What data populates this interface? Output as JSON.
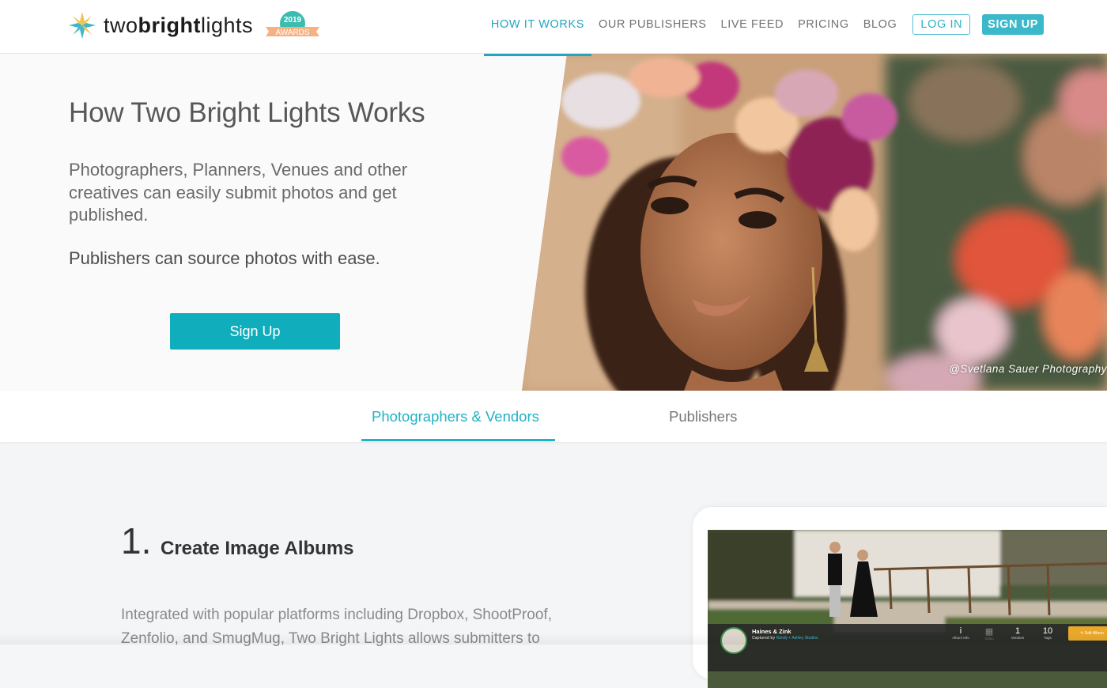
{
  "header": {
    "logo": {
      "text_light_1": "two",
      "text_bold": "bright",
      "text_light_2": "lights"
    },
    "award_badge": {
      "year": "2019",
      "label": "AWARDS"
    },
    "nav": [
      {
        "label": "HOW IT WORKS",
        "active": true
      },
      {
        "label": "OUR PUBLISHERS",
        "active": false
      },
      {
        "label": "LIVE FEED",
        "active": false
      },
      {
        "label": "PRICING",
        "active": false
      },
      {
        "label": "BLOG",
        "active": false
      }
    ],
    "login_label": "LOG IN",
    "signup_label": "SIGN UP"
  },
  "hero": {
    "title": "How Two Bright Lights Works",
    "description": "Photographers, Planners, Venues and other creatives can easily submit photos and get published.",
    "subtitle": "Publishers can source photos with ease.",
    "cta_label": "Sign Up",
    "photo_credit": "@Svetlana Sauer Photography"
  },
  "tabs": [
    {
      "label": "Photographers & Vendors",
      "active": true
    },
    {
      "label": "Publishers",
      "active": false
    }
  ],
  "step": {
    "number": "1.",
    "title": "Create Image Albums",
    "text": "Integrated with popular platforms including Dropbox, ShootProof, Zenfolio, and SmugMug, Two Bright Lights allows submitters to"
  },
  "album_preview": {
    "name": "Haines & Zink",
    "captured_by_prefix": "Captured by",
    "captured_by": "Randy + Ashley Studios",
    "stats": [
      {
        "value": "i",
        "label": "Album Info"
      },
      {
        "value": "▦",
        "label": "Video"
      },
      {
        "value": "1",
        "label": "Vendors"
      },
      {
        "value": "10",
        "label": "Tags"
      }
    ],
    "edit_label": "Edit Album"
  },
  "colors": {
    "accent": "#26a4bf",
    "button": "#10aebc",
    "edit_button": "#e9a82b"
  }
}
